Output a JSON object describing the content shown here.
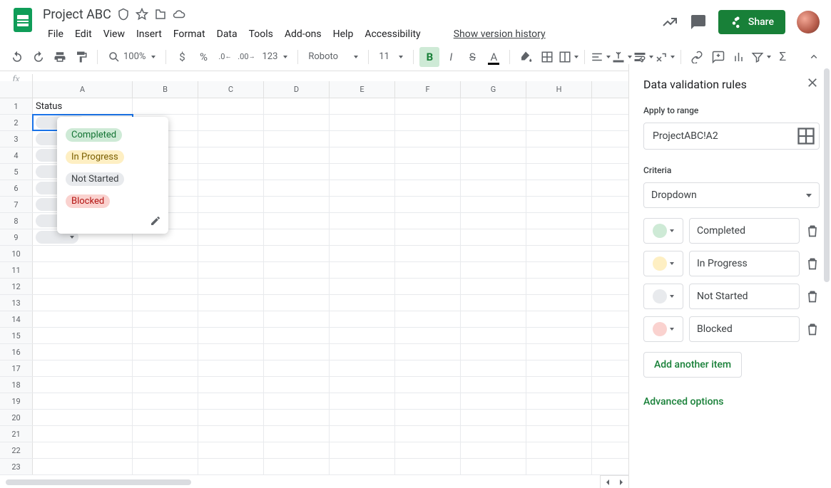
{
  "doc": {
    "title": "Project ABC"
  },
  "menus": [
    "File",
    "Edit",
    "View",
    "Insert",
    "Format",
    "Data",
    "Tools",
    "Add-ons",
    "Help",
    "Accessibility"
  ],
  "version_history": "Show version history",
  "share_label": "Share",
  "toolbar": {
    "zoom": "100%",
    "number_fmt": "123",
    "font": "Roboto",
    "font_size": "11"
  },
  "columns": [
    "A",
    "B",
    "C",
    "D",
    "E",
    "F",
    "G",
    "H"
  ],
  "row_count": 23,
  "a1_value": "Status",
  "dropdown_options": [
    {
      "label": "Completed",
      "cls": "c-green"
    },
    {
      "label": "In Progress",
      "cls": "c-yellow"
    },
    {
      "label": "Not Started",
      "cls": "c-grey"
    },
    {
      "label": "Blocked",
      "cls": "c-red"
    }
  ],
  "panel": {
    "title": "Data validation rules",
    "apply_label": "Apply to range",
    "range": "ProjectABC!A2",
    "criteria_label": "Criteria",
    "criteria_type": "Dropdown",
    "items": [
      {
        "value": "Completed",
        "sw": "sw-green"
      },
      {
        "value": "In Progress",
        "sw": "sw-yellow"
      },
      {
        "value": "Not Started",
        "sw": "sw-grey"
      },
      {
        "value": "Blocked",
        "sw": "sw-red"
      }
    ],
    "add_item": "Add another item",
    "advanced": "Advanced options"
  }
}
